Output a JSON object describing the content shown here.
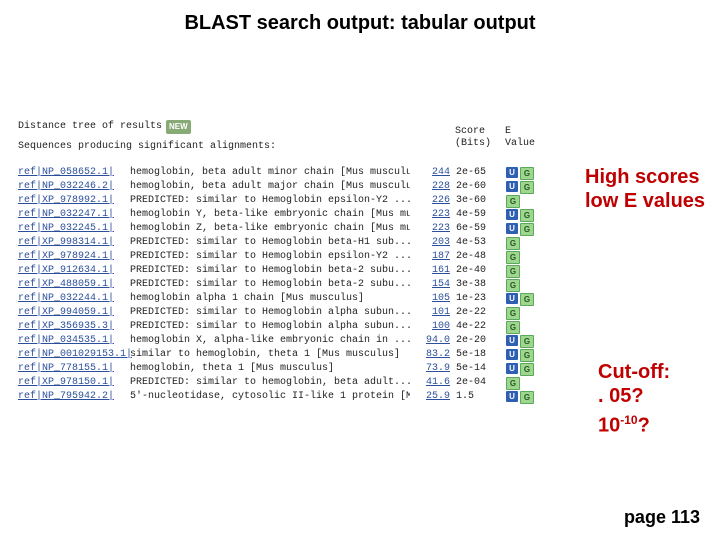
{
  "slide": {
    "title": "BLAST search output: tabular output",
    "distance_tree_label": "Distance tree of results",
    "new_badge": "NEW",
    "subhead": "Sequences producing significant alignments:",
    "headers": {
      "score1": "Score",
      "score2": "(Bits)",
      "eval1": "E",
      "eval2": "Value"
    },
    "rows": [
      {
        "acc": "ref|NP_058652.1|",
        "desc": "hemoglobin, beta adult minor chain [Mus musculu",
        "score": "244",
        "ev": "2e-65",
        "u": true,
        "g": true
      },
      {
        "acc": "ref|NP_032246.2|",
        "desc": "hemoglobin, beta adult major chain [Mus musculu",
        "score": "228",
        "ev": "2e-60",
        "u": true,
        "g": true
      },
      {
        "acc": "ref|XP_978992.1|",
        "desc": "PREDICTED: similar to Hemoglobin epsilon-Y2 ...",
        "score": "226",
        "ev": "3e-60",
        "u": false,
        "g": true
      },
      {
        "acc": "ref|NP_032247.1|",
        "desc": "hemoglobin Y, beta-like embryonic chain [Mus mu",
        "score": "223",
        "ev": "4e-59",
        "u": true,
        "g": true
      },
      {
        "acc": "ref|NP_032245.1|",
        "desc": "hemoglobin Z, beta-like embryonic chain [Mus mu",
        "score": "223",
        "ev": "6e-59",
        "u": true,
        "g": true
      },
      {
        "acc": "ref|XP_998314.1|",
        "desc": "PREDICTED: similar to Hemoglobin beta-H1 sub...",
        "score": "203",
        "ev": "4e-53",
        "u": false,
        "g": true
      },
      {
        "acc": "ref|XP_978924.1|",
        "desc": "PREDICTED: similar to Hemoglobin epsilon-Y2 ...",
        "score": "187",
        "ev": "2e-48",
        "u": false,
        "g": true
      },
      {
        "acc": "ref|XP_912634.1|",
        "desc": "PREDICTED: similar to Hemoglobin beta-2 subu...",
        "score": "161",
        "ev": "2e-40",
        "u": false,
        "g": true
      },
      {
        "acc": "ref|XP_488059.1|",
        "desc": "PREDICTED: similar to Hemoglobin beta-2 subu...",
        "score": "154",
        "ev": "3e-38",
        "u": false,
        "g": true
      },
      {
        "acc": "ref|NP_032244.1|",
        "desc": "hemoglobin alpha 1 chain [Mus musculus]",
        "score": "105",
        "ev": "1e-23",
        "u": true,
        "g": true
      },
      {
        "acc": "ref|XP_994059.1|",
        "desc": "PREDICTED: similar to Hemoglobin alpha subun...",
        "score": "101",
        "ev": "2e-22",
        "u": false,
        "g": true
      },
      {
        "acc": "ref|XP_356935.3|",
        "desc": "PREDICTED: similar to Hemoglobin alpha subun...",
        "score": "100",
        "ev": "4e-22",
        "u": false,
        "g": true
      },
      {
        "acc": "ref|NP_034535.1|",
        "desc": "hemoglobin X, alpha-like embryonic chain in ...",
        "score": "94.0",
        "ev": "2e-20",
        "u": true,
        "g": true
      },
      {
        "acc": "ref|NP_001029153.1|",
        "desc": "  similar to hemoglobin, theta 1 [Mus musculus]",
        "score": "83.2",
        "ev": "5e-18",
        "u": true,
        "g": true,
        "long": true
      },
      {
        "acc": "ref|NP_778155.1|",
        "desc": "hemoglobin, theta 1 [Mus musculus]",
        "score": "73.9",
        "ev": "5e-14",
        "u": true,
        "g": true
      },
      {
        "acc": "ref|XP_978150.1|",
        "desc": "PREDICTED: similar to hemoglobin, beta adult...",
        "score": "41.6",
        "ev": "2e-04",
        "u": false,
        "g": true
      },
      {
        "acc": "ref|NP_795942.2|",
        "desc": "5'-nucleotidase, cytosolic II-like 1 protein [M",
        "score": "25.9",
        "ev": "1.5",
        "u": true,
        "g": true
      }
    ],
    "ann_top_line1": "High scores",
    "ann_top_line2": "low E values",
    "ann_bottom_line1": "Cut-off:",
    "ann_bottom_line2": ". 05?",
    "ann_bottom_line3_prefix": "10",
    "ann_bottom_line3_sup": "-10",
    "ann_bottom_line3_suffix": "?",
    "page_label": "page 113"
  }
}
